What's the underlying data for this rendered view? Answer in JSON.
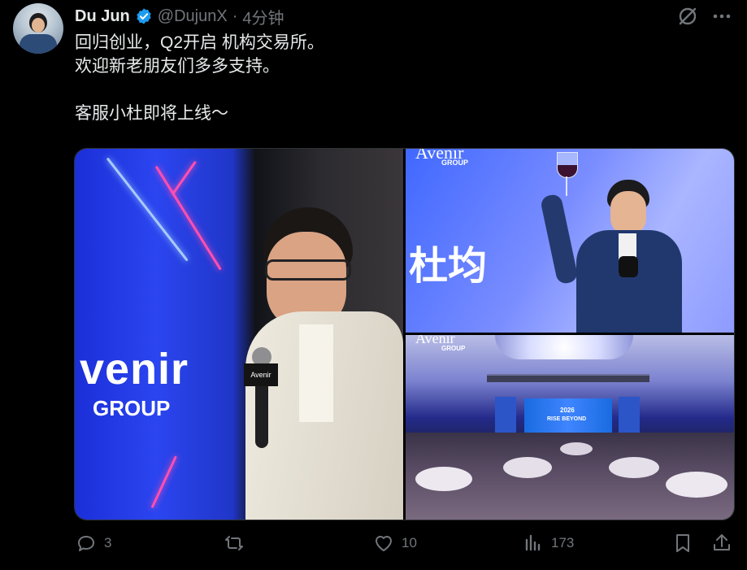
{
  "tweet": {
    "author_name": "Du Jun",
    "handle": "@DujunX",
    "separator": "·",
    "time": "4分钟",
    "lines": [
      "回归创业，Q2开启 机构交易所。",
      "欢迎新老朋友们多多支持。",
      "",
      "客服小杜即将上线～"
    ]
  },
  "media": {
    "left_photo_text": {
      "brand": "venir",
      "group": "GROUP",
      "mic_brand": "Avenir"
    },
    "top_right_photo_text": {
      "brand": "Avenir",
      "group": "GROUP",
      "name": "杜均"
    },
    "bottom_right_photo_text": {
      "brand": "Avenir",
      "group": "GROUP",
      "stage_year": "2026",
      "stage_slogan": "RISE BEYOND"
    }
  },
  "actions": {
    "replies": "3",
    "retweets": "",
    "likes": "10",
    "views": "173"
  },
  "icons": {
    "verified": "verified-badge-icon",
    "grok": "grok-icon",
    "more": "more-icon"
  },
  "colors": {
    "background": "#000000",
    "text": "#e7e9ea",
    "muted": "#71767b",
    "verified_blue": "#1d9bf0"
  }
}
